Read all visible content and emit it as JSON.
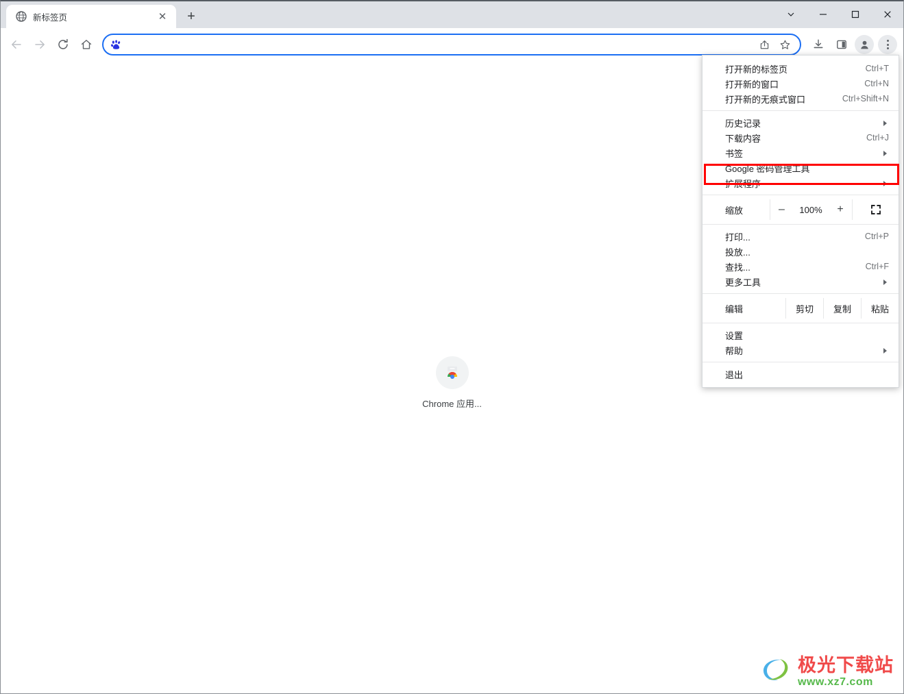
{
  "window": {
    "controls": [
      {
        "name": "minimize-to-tray",
        "glyph": "chevron-down"
      },
      {
        "name": "minimize",
        "glyph": "minimize"
      },
      {
        "name": "maximize",
        "glyph": "maximize"
      },
      {
        "name": "close",
        "glyph": "close"
      }
    ]
  },
  "tabstrip": {
    "tabs": [
      {
        "title": "新标签页",
        "favicon": "globe-icon",
        "close_glyph": "✕"
      }
    ],
    "new_tab_glyph": "+"
  },
  "toolbar": {
    "back_label": "后退",
    "forward_label": "前进",
    "reload_label": "重新加载",
    "home_label": "主页",
    "omnibox": {
      "value": "",
      "placeholder": "",
      "site_icon": "baidu-paw-icon",
      "share_label": "分享",
      "bookmark_label": "收藏"
    },
    "download_label": "下载内容",
    "side_panel_label": "侧边栏",
    "profile_label": "个人资料",
    "menu_label": "自定义及控制 Google Chrome"
  },
  "content": {
    "apps_shortcut": {
      "label": "Chrome 应用...",
      "icon": "chrome-apps-icon"
    }
  },
  "menu": {
    "groups": [
      {
        "items": [
          {
            "label": "打开新的标签页",
            "accel": "Ctrl+T",
            "submenu": false
          },
          {
            "label": "打开新的窗口",
            "accel": "Ctrl+N",
            "submenu": false
          },
          {
            "label": "打开新的无痕式窗口",
            "accel": "Ctrl+Shift+N",
            "submenu": false
          }
        ]
      },
      {
        "items": [
          {
            "label": "历史记录",
            "accel": "",
            "submenu": true
          },
          {
            "label": "下载内容",
            "accel": "Ctrl+J",
            "submenu": false
          },
          {
            "label": "书签",
            "accel": "",
            "submenu": true
          },
          {
            "label": "Google 密码管理工具",
            "accel": "",
            "submenu": false
          },
          {
            "label": "扩展程序",
            "accel": "",
            "submenu": true,
            "highlighted": true
          }
        ]
      }
    ],
    "zoom_row": {
      "label": "缩放",
      "minus": "–",
      "value": "100%",
      "plus": "+",
      "fullscreen_name": "fullscreen-icon"
    },
    "middle_items": [
      {
        "label": "打印...",
        "accel": "Ctrl+P",
        "submenu": false
      },
      {
        "label": "投放...",
        "accel": "",
        "submenu": false
      },
      {
        "label": "查找...",
        "accel": "Ctrl+F",
        "submenu": false
      },
      {
        "label": "更多工具",
        "accel": "",
        "submenu": true
      }
    ],
    "edit_row": {
      "label": "编辑",
      "cut": "剪切",
      "copy": "复制",
      "paste": "粘贴"
    },
    "settings_items": [
      {
        "label": "设置",
        "accel": "",
        "submenu": false
      },
      {
        "label": "帮助",
        "accel": "",
        "submenu": true
      }
    ],
    "exit_item": {
      "label": "退出",
      "accel": "",
      "submenu": false
    }
  },
  "watermark": {
    "title": "极光下载站",
    "url": "www.xz7.com"
  },
  "colors": {
    "accent": "#1b6ef3",
    "highlight": "#ff0000",
    "tabstrip": "#dee1e6"
  }
}
